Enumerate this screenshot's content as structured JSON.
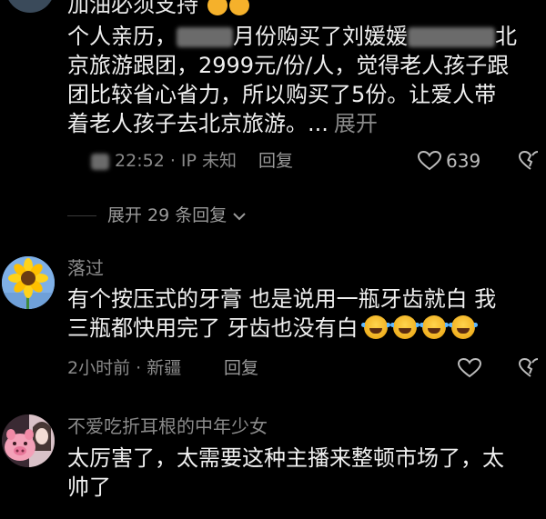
{
  "comment1": {
    "partial_text": "加油必须支持",
    "text_lines": [
      {
        "before": "个人亲历，",
        "after": "月份购买了刘媛媛",
        "tail": "北"
      },
      {
        "text": "京旅游跟团，2999元/份/人，觉得老人孩子跟"
      },
      {
        "text": "团比较省心省力，所以购买了5份。让爱人带"
      },
      {
        "text": "着老人孩子去北京旅游。..."
      }
    ],
    "expand_label": "展开",
    "meta": "22:52 · IP 未知",
    "reply_label": "回复",
    "like_count": "639",
    "replies_label": "展开 29 条回复"
  },
  "comment2": {
    "username": "落过",
    "text_lines": [
      "有个按压式的牙膏  也是说用一瓶牙齿就白  我",
      "三瓶都快用完了  牙齿也没有白"
    ],
    "meta": "2小时前 · 新疆",
    "reply_label": "回复"
  },
  "comment3": {
    "username": "不爱吃折耳根的中年少女",
    "text_lines": [
      "太厉害了，太需要这种主播来整顿市场了，太",
      "帅了"
    ]
  },
  "colors": {
    "background": "#000000",
    "text": "#f0f0f0",
    "muted": "#8a8a8a"
  }
}
